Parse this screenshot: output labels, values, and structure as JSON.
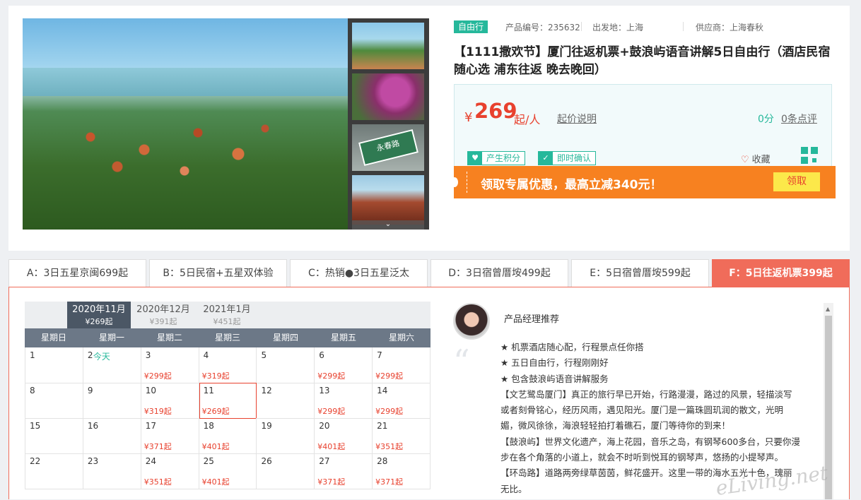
{
  "product": {
    "tag": "自由行",
    "code_label": "产品编号：235632",
    "departure_label": "出发地：上海",
    "supplier_label": "供应商：上海春秋",
    "title": "【1111撒欢节】厦门往返机票+鼓浪屿语音讲解5日自由行（酒店民宿随心选 浦东往返 晚去晚回）"
  },
  "gallery": {
    "thumb_sign_text": "永春路",
    "more_icon": "chevron-down-icon"
  },
  "price": {
    "currency": "¥",
    "amount": "269",
    "unit": "起/人",
    "explain_link": "起价说明",
    "score": "0分",
    "reviews_link": "0条点评"
  },
  "badges": [
    {
      "icon": "shield-icon",
      "label": "产生积分"
    },
    {
      "icon": "check-icon",
      "label": "即时确认"
    }
  ],
  "favorite_label": "收藏",
  "promo": {
    "text": "领取专属优惠，最高立减340元！",
    "button": "领取"
  },
  "tabs": [
    {
      "label": "A：3日五星京闽699起",
      "active": false
    },
    {
      "label": "B：5日民宿+五星双体验",
      "active": false
    },
    {
      "label": "C：热销●3日五星泛太",
      "active": false
    },
    {
      "label": "D：3日宿曾厝垵499起",
      "active": false
    },
    {
      "label": "E：5日宿曾厝垵599起",
      "active": false
    },
    {
      "label": "F：5日往返机票399起",
      "active": true
    }
  ],
  "calendar": {
    "months": [
      {
        "label": "2020年11月",
        "price": "¥269起",
        "active": true
      },
      {
        "label": "2020年12月",
        "price": "¥391起",
        "active": false
      },
      {
        "label": "2021年1月",
        "price": "¥451起",
        "active": false
      }
    ],
    "weekdays": [
      "星期日",
      "星期一",
      "星期二",
      "星期三",
      "星期四",
      "星期五",
      "星期六"
    ],
    "weeks": [
      [
        {
          "d": "1",
          "p": ""
        },
        {
          "d": "2",
          "today": "今天",
          "p": ""
        },
        {
          "d": "3",
          "p": "¥299起"
        },
        {
          "d": "4",
          "p": "¥319起"
        },
        {
          "d": "5",
          "p": ""
        },
        {
          "d": "6",
          "p": "¥299起"
        },
        {
          "d": "7",
          "p": "¥299起"
        }
      ],
      [
        {
          "d": "8",
          "p": ""
        },
        {
          "d": "9",
          "p": ""
        },
        {
          "d": "10",
          "p": "¥319起"
        },
        {
          "d": "11",
          "p": "¥269起",
          "sel": true
        },
        {
          "d": "12",
          "p": ""
        },
        {
          "d": "13",
          "p": "¥299起"
        },
        {
          "d": "14",
          "p": "¥299起"
        }
      ],
      [
        {
          "d": "15",
          "p": ""
        },
        {
          "d": "16",
          "p": ""
        },
        {
          "d": "17",
          "p": "¥371起"
        },
        {
          "d": "18",
          "p": "¥401起"
        },
        {
          "d": "19",
          "p": ""
        },
        {
          "d": "20",
          "p": "¥401起"
        },
        {
          "d": "21",
          "p": "¥351起"
        }
      ],
      [
        {
          "d": "22",
          "p": ""
        },
        {
          "d": "23",
          "p": ""
        },
        {
          "d": "24",
          "p": "¥351起"
        },
        {
          "d": "25",
          "p": "¥401起"
        },
        {
          "d": "26",
          "p": ""
        },
        {
          "d": "27",
          "p": "¥371起"
        },
        {
          "d": "28",
          "p": "¥371起"
        }
      ]
    ]
  },
  "recommend": {
    "title": "产品经理推荐",
    "lines": [
      "★ 机票酒店随心配，行程景点任你搭",
      "★ 五日自由行，行程刚刚好",
      "★ 包含鼓浪屿语音讲解服务",
      "【文艺鹭岛厦门】真正的旅行早已开始，行路漫漫，路过的风景，轻描淡写",
      "或者刻骨铭心，经历风雨，遇见阳光。厦门是一篇珠圆玑润的散文，光明",
      "媚，微风徐徐，海浪轻轻拍打着礁石，厦门等待你的到来！",
      "【鼓浪屿】世界文化遗产，海上花园，音乐之岛，有钢琴600多台，只要你漫",
      "步在各个角落的小道上，就会不时听到悦耳的钢琴声，悠扬的小提琴声。",
      "【环岛路】道路两旁绿草茵茵，鲜花盛开。这里一带的海水五光十色，瑰丽",
      "无比。"
    ]
  },
  "watermark": "eLiving.net"
}
